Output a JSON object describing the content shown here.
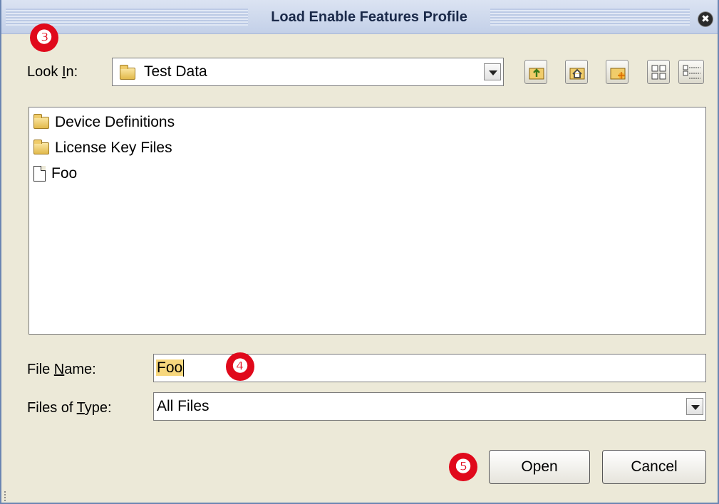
{
  "window": {
    "title": "Load Enable Features Profile",
    "close_glyph": "✖"
  },
  "callouts": [
    "❸",
    "❹",
    "❺"
  ],
  "look_in": {
    "label_pre": "Look ",
    "label_mnemonic": "I",
    "label_post": "n:",
    "value": "Test Data",
    "icon": "folder-icon"
  },
  "toolbar": {
    "buttons": [
      {
        "name": "up-one-level-button",
        "icon": "folder-up-icon"
      },
      {
        "name": "home-button",
        "icon": "home-icon"
      },
      {
        "name": "new-folder-button",
        "icon": "new-folder-icon"
      },
      {
        "name": "list-view-button",
        "icon": "list-view-icon"
      },
      {
        "name": "details-view-button",
        "icon": "details-view-icon"
      }
    ]
  },
  "file_list": {
    "items": [
      {
        "label": "Device Definitions",
        "icon": "folder-icon"
      },
      {
        "label": "License Key Files",
        "icon": "folder-icon"
      },
      {
        "label": "Foo",
        "icon": "file-icon"
      }
    ]
  },
  "file_name": {
    "label_pre": "File ",
    "label_mnemonic": "N",
    "label_post": "ame:",
    "value": "Foo"
  },
  "file_type": {
    "label_pre": "Files of ",
    "label_mnemonic": "T",
    "label_post": "ype:",
    "value": "All Files"
  },
  "buttons": {
    "open": "Open",
    "cancel": "Cancel"
  },
  "colors": {
    "callout": "#e0091b",
    "selection": "#f7d77d",
    "window_bg": "#ece9d8"
  }
}
